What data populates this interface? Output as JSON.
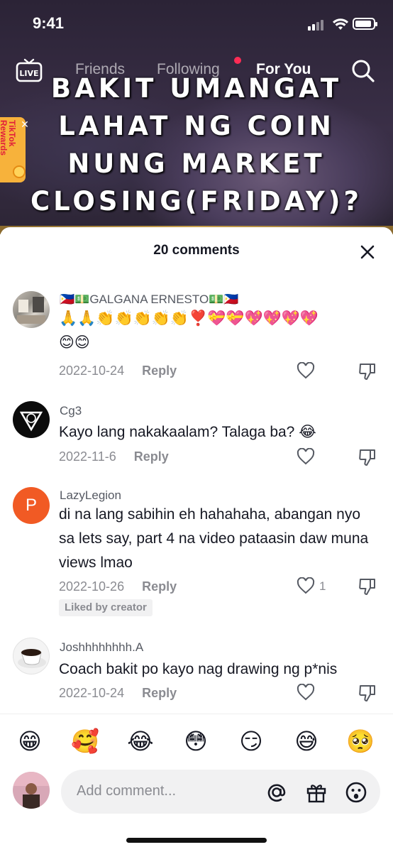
{
  "status_bar": {
    "time": "9:41"
  },
  "top_nav": {
    "live_label": "LIVE",
    "tabs": [
      {
        "label": "Friends"
      },
      {
        "label": "Following"
      },
      {
        "label": "For You",
        "active": true
      }
    ]
  },
  "video": {
    "overlay_lines": [
      "BAKIT UMANGAT",
      "LAHAT NG COIN",
      "NUNG MARKET",
      "CLOSING(FRIDAY)?"
    ],
    "rewards_label": "TikTok Rewards"
  },
  "comments_panel": {
    "title": "20 comments",
    "comments": [
      {
        "username": "🇵🇭💵GALGANA ERNESTO💵🇵🇭",
        "text_line1": "🙏🙏👏👏👏👏👏❣️💝💝💖💖💖💖",
        "text_line2": "😊😊",
        "date": "2022-10-24",
        "reply_label": "Reply"
      },
      {
        "username": "Cg3",
        "text": "Kayo lang nakakaalam? Talaga ba? 😂",
        "date": "2022-11-6",
        "reply_label": "Reply"
      },
      {
        "username": "LazyLegion",
        "text": "di na lang sabihin eh hahahaha, abangan nyo sa lets say, part 4 na video pataasin daw muna views lmao",
        "date": "2022-10-26",
        "reply_label": "Reply",
        "like_count": "1",
        "badge": "Liked by creator",
        "avatar_letter": "P"
      },
      {
        "username": "Joshhhhhhhh.A",
        "text": "Coach bakit po kayo nag drawing ng p*nis",
        "date": "2022-10-24",
        "reply_label": "Reply"
      }
    ]
  },
  "emoji_bar": [
    "😁",
    "🥰",
    "😂",
    "😳",
    "😏",
    "😅",
    "🥺"
  ],
  "input": {
    "placeholder": "Add comment..."
  },
  "colors": {
    "accent": "#fe2c55",
    "rewards": "#f7b23b",
    "muted_text": "#8a8b91",
    "input_bg": "#f1f1f2",
    "avatar_orange": "#f15a24"
  }
}
